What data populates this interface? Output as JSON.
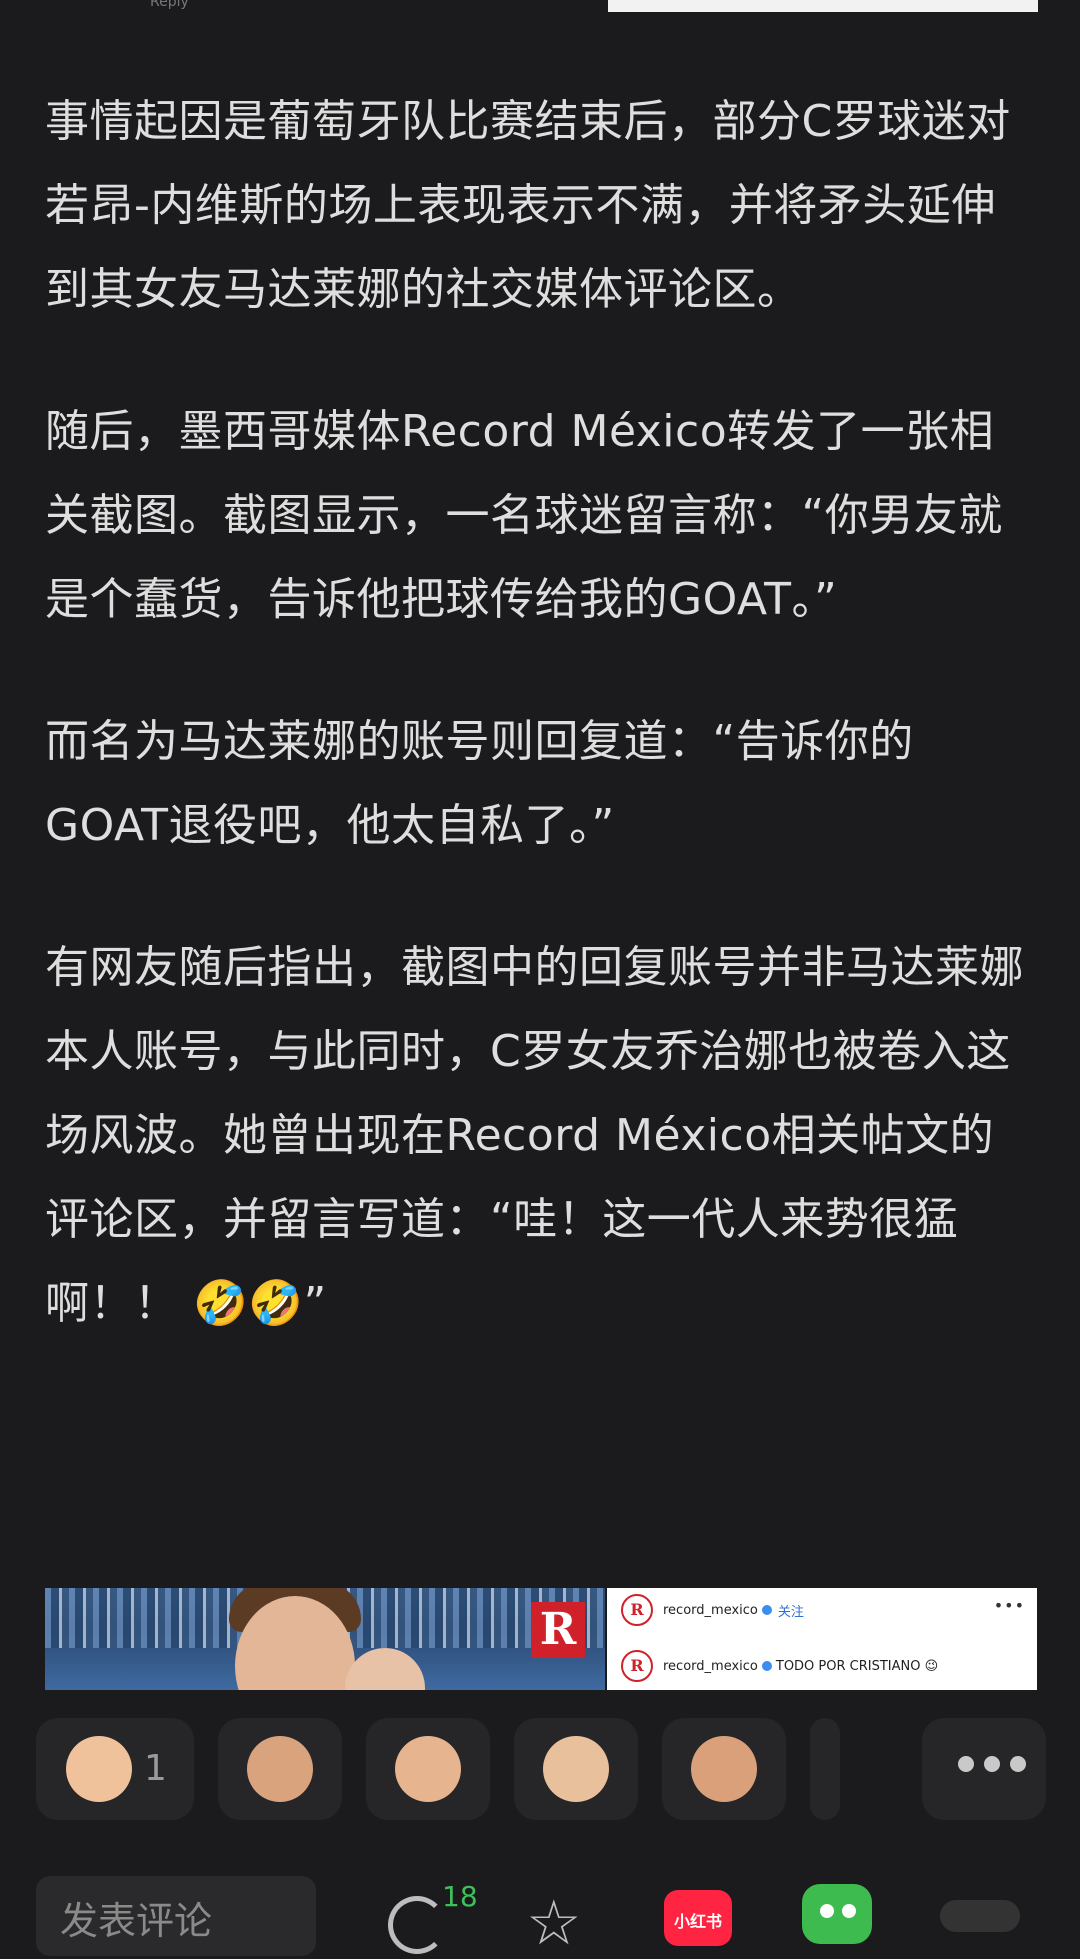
{
  "top_strip": {
    "fragment_text": "Reply"
  },
  "article": {
    "paragraphs": [
      "事情起因是葡萄牙队比赛结束后，部分C罗球迷对若昂-内维斯的场上表现表示不满，并将矛头延伸到其女友马达莱娜的社交媒体评论区。",
      "随后，墨西哥媒体Record México转发了一张相关截图。截图显示，一名球迷留言称：“你男友就是个蠢货，告诉他把球传给我的GOAT。”",
      "而名为马达莱娜的账号则回复道：“告诉你的GOAT退役吧，他太自私了。”",
      "有网友随后指出，截图中的回复账号并非马达莱娜本人账号，与此同时，C罗女友乔治娜也被卷入这场风波。她曾出现在Record México相关帖文的评论区，并留言写道：“哇！这一代人来势很猛啊！！ 🤣🤣”"
    ]
  },
  "embed": {
    "logo_letter": "R",
    "ig_account": "record_mexico",
    "follow_label": "关注",
    "caption": "TODO POR CRISTIANO 😉",
    "more": "•••"
  },
  "reactions": {
    "items": [
      {
        "icon": "sweating-face-avatar-icon",
        "count": "1",
        "skin": "#f0c29b"
      },
      {
        "icon": "angry-face-avatar-icon",
        "count": "",
        "skin": "#d9a37d"
      },
      {
        "icon": "thinking-face-avatar-icon",
        "count": "",
        "skin": "#e6b48e"
      },
      {
        "icon": "bald-face-avatar-icon",
        "count": "",
        "skin": "#e9c09c"
      },
      {
        "icon": "bearded-face-avatar-icon",
        "count": "",
        "skin": "#d9a07a"
      }
    ],
    "more_icon": "more-dots-icon"
  },
  "bottom_bar": {
    "comment_placeholder": "发表评论",
    "comment_count": "18",
    "xhs_label": "小红书"
  },
  "colors": {
    "background": "#1b1b1d",
    "text": "#dedede",
    "accent_green": "#3fbf5a",
    "xhs_red": "#ff2442",
    "record_red": "#d0202a"
  }
}
